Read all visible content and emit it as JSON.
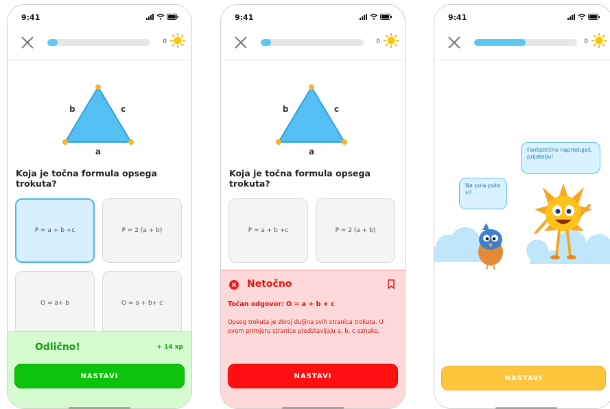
{
  "status": {
    "time": "9:41"
  },
  "screens": [
    {
      "progress_fraction": 0.1,
      "points": "0",
      "triangle": {
        "side_b": "b",
        "side_c": "c",
        "side_a": "a"
      },
      "question": "Koja je točna formula opsega trokuta?",
      "options": [
        "P = a + b +c",
        "P = 2 (a + b)",
        "O = a+ b",
        "O = a + b+ c"
      ],
      "feedback": {
        "title": "Odlično!",
        "xp": "+ 14 xp"
      },
      "button": "NASTAVI"
    },
    {
      "progress_fraction": 0.1,
      "points": "0",
      "triangle": {
        "side_b": "b",
        "side_c": "c",
        "side_a": "a"
      },
      "question": "Koja je točna formula opsega trokuta?",
      "options": [
        "P = a + b +c",
        "P = 2 (a + b)"
      ],
      "feedback": {
        "title": "Netočno",
        "answer": "Točan odgovor: O = a + b + c",
        "explanation": "Opseg trokuta je zbroj duljina svih stranica trokuta. U ovom primjeru stranice predstavljaju a, b, c oznake."
      },
      "button": "NASTAVI"
    },
    {
      "progress_fraction": 0.5,
      "points": "0",
      "bubble_bird": "Na pola puta si!",
      "bubble_sun": "Fantastično napreduješ, prijatelju!",
      "button": "NASTAVI"
    }
  ],
  "colors": {
    "correct": "#0cc40c",
    "wrong": "#ff0f0f",
    "accent": "#5cc8f2",
    "continue": "#ffc53d"
  }
}
